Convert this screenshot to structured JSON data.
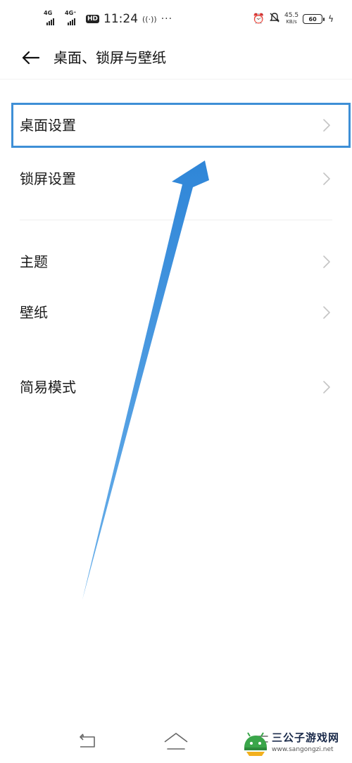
{
  "status_bar": {
    "net1": "4G",
    "net2": "4G⁺",
    "hd": "HD",
    "time": "11:24",
    "more": "···",
    "speed_value": "45.5",
    "speed_unit": "KB/s",
    "battery_level": "60",
    "icons": [
      "signal-icon",
      "signal-icon",
      "hd-voice-icon",
      "wifi-calling-icon",
      "alarm-icon",
      "mute-icon",
      "battery-icon",
      "charging-icon"
    ]
  },
  "header": {
    "title": "桌面、锁屏与壁纸",
    "back_icon": "back-arrow-icon"
  },
  "list": {
    "items": [
      {
        "label": "桌面设置"
      },
      {
        "label": "锁屏设置"
      },
      {
        "label": "主题"
      },
      {
        "label": "壁纸"
      },
      {
        "label": "简易模式"
      }
    ]
  },
  "annotation": {
    "highlight_color": "#3e8fd6",
    "arrow_color": "#3e8fd6"
  },
  "navbar": {
    "icons": [
      "back-nav-icon",
      "home-nav-icon",
      "recents-nav-icon"
    ]
  },
  "watermark": {
    "title": "三公子游戏网",
    "url": "www.sangongzi.net"
  }
}
